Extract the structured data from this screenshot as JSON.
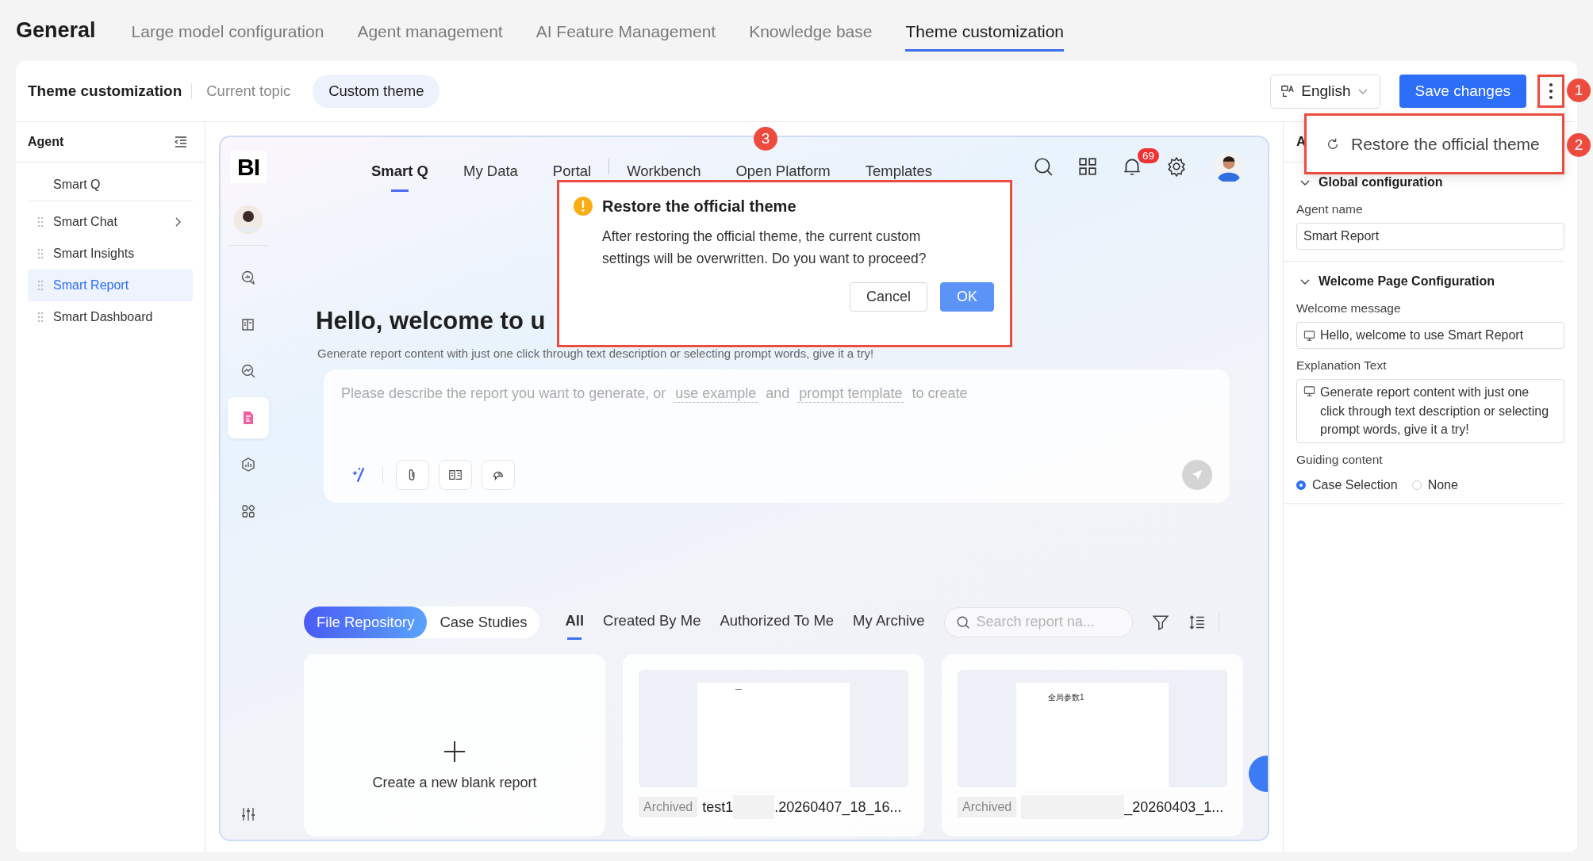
{
  "page_title": "General",
  "tabs": [
    {
      "label": "Large model configuration",
      "selected": false
    },
    {
      "label": "Agent management",
      "selected": false
    },
    {
      "label": "AI Feature Management",
      "selected": false
    },
    {
      "label": "Knowledge base",
      "selected": false
    },
    {
      "label": "Theme customization",
      "selected": true
    }
  ],
  "header": {
    "title": "Theme customization",
    "segments": [
      {
        "label": "Current topic",
        "selected": false
      },
      {
        "label": "Custom theme",
        "selected": true
      }
    ],
    "language": "English",
    "save_button": "Save changes"
  },
  "more_menu": {
    "items": [
      "Restore the official theme"
    ]
  },
  "annotations": [
    "1",
    "2",
    "3"
  ],
  "sidebar": {
    "title": "Agent",
    "items": [
      {
        "label": "Smart Q",
        "selected": false,
        "draggable": false,
        "expandable": false
      },
      {
        "label": "Smart Chat",
        "selected": false,
        "draggable": true,
        "expandable": true
      },
      {
        "label": "Smart Insights",
        "selected": false,
        "draggable": true,
        "expandable": false
      },
      {
        "label": "Smart Report",
        "selected": true,
        "draggable": true,
        "expandable": false
      },
      {
        "label": "Smart Dashboard",
        "selected": false,
        "draggable": true,
        "expandable": false
      }
    ]
  },
  "preview": {
    "logo": "BI",
    "rail": [
      {
        "kind": "avatar",
        "selected": false
      },
      {
        "kind": "chat",
        "selected": false
      },
      {
        "kind": "book",
        "selected": false
      },
      {
        "kind": "insight",
        "selected": false
      },
      {
        "kind": "report",
        "selected": true
      },
      {
        "kind": "dashboard",
        "selected": false
      },
      {
        "kind": "apps",
        "selected": false
      }
    ],
    "nav": [
      {
        "label": "Smart Q",
        "selected": true
      },
      {
        "label": "My Data",
        "selected": false
      },
      {
        "label": "Portal",
        "selected": false
      },
      {
        "label": "Workbench",
        "selected": false
      },
      {
        "label": "Open Platform",
        "selected": false
      },
      {
        "label": "Templates",
        "selected": false
      }
    ],
    "notification_count": "69",
    "heading": "Hello, welcome to u",
    "subtitle": "Generate report content with just one click through text description or selecting prompt words, give it a try!",
    "prompt": [
      {
        "kind": "text",
        "text": "Please describe the report you want to generate, or"
      },
      {
        "kind": "link",
        "text": "use example"
      },
      {
        "kind": "text",
        "text": "and"
      },
      {
        "kind": "link",
        "text": "prompt template"
      },
      {
        "kind": "text",
        "text": "to create"
      }
    ],
    "library_tabs": [
      {
        "label": "File Repository",
        "selected": true
      },
      {
        "label": "Case Studies",
        "selected": false
      }
    ],
    "filter_tabs": [
      {
        "label": "All",
        "selected": true
      },
      {
        "label": "Created By Me",
        "selected": false
      },
      {
        "label": "Authorized To Me",
        "selected": false
      },
      {
        "label": "My Archive",
        "selected": false
      }
    ],
    "search": {
      "placeholder": "Search report na..."
    },
    "cards": [
      {
        "kind": "create",
        "label": "Create a new blank report"
      },
      {
        "kind": "report",
        "tag": "Archived",
        "name_parts": [
          {
            "kind": "text",
            "text": "test1"
          },
          {
            "kind": "redacted"
          },
          {
            "kind": "text",
            "text": ".20260407_18_16..."
          }
        ]
      },
      {
        "kind": "report",
        "tag": "Archived",
        "thumbnail_text": "全局参数1",
        "name_parts": [
          {
            "kind": "redacted"
          },
          {
            "kind": "text",
            "text": "_20260403_1..."
          }
        ]
      }
    ]
  },
  "dialog": {
    "title": "Restore the official theme",
    "message": "After restoring the official theme, the current custom settings will be overwritten. Do you want to proceed?",
    "buttons": [
      {
        "label": "Cancel",
        "kind": "default"
      },
      {
        "label": "OK",
        "kind": "primary"
      }
    ]
  },
  "settings_panel": {
    "title": "A",
    "sections": [
      {
        "title": "Global configuration",
        "expanded": true,
        "fields": [
          {
            "kind": "input",
            "label": "Agent name",
            "value": "Smart Report",
            "has_icon": false
          }
        ]
      },
      {
        "title": "Welcome Page Configuration",
        "expanded": true,
        "fields": [
          {
            "kind": "input",
            "label": "Welcome message",
            "value": "Hello, welcome to use Smart Report",
            "has_icon": true
          },
          {
            "kind": "textarea",
            "label": "Explanation Text",
            "value": "Generate report content with just one click through text description or selecting prompt words, give it a try!",
            "has_icon": true
          },
          {
            "kind": "radio",
            "label": "Guiding content",
            "options": [
              {
                "label": "Case Selection",
                "selected": true
              },
              {
                "label": "None",
                "selected": false
              }
            ]
          }
        ]
      }
    ]
  }
}
